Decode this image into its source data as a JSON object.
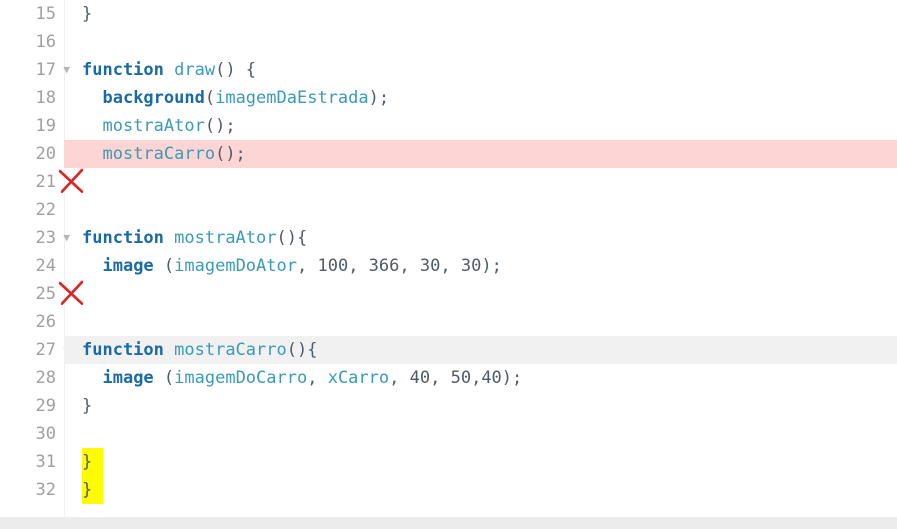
{
  "gutter": {
    "lines": [
      "15",
      "16",
      "17",
      "18",
      "19",
      "20",
      "21",
      "22",
      "23",
      "24",
      "25",
      "26",
      "27",
      "28",
      "29",
      "30",
      "31",
      "32"
    ]
  },
  "code": {
    "l15": {
      "t1": "}"
    },
    "l16": {},
    "l17": {
      "t1": "function",
      "t2": " ",
      "t3": "draw",
      "t4": "() {"
    },
    "l18": {
      "t1": "  ",
      "t2": "background",
      "t3": "(",
      "t4": "imagemDaEstrada",
      "t5": ");"
    },
    "l19": {
      "t1": "  ",
      "t2": "mostraAtor",
      "t3": "();"
    },
    "l20": {
      "t1": "  ",
      "t2": "mostraCarro",
      "t3": "();"
    },
    "l21": {},
    "l22": {},
    "l23": {
      "t1": "function",
      "t2": " ",
      "t3": "mostraAtor",
      "t4": "(){"
    },
    "l24": {
      "t1": "  ",
      "t2": "image",
      "t3": " (",
      "t4": "imagemDoAtor",
      "t5": ", ",
      "t6": "100",
      "t7": ", ",
      "t8": "366",
      "t9": ", ",
      "t10": "30",
      "t11": ", ",
      "t12": "30",
      "t13": ");"
    },
    "l25": {},
    "l26": {},
    "l27": {
      "t1": "function",
      "t2": " ",
      "t3": "mostraCarro",
      "t4": "(){"
    },
    "l28": {
      "t1": "  ",
      "t2": "image",
      "t3": " (",
      "t4": "imagemDoCarro",
      "t5": ", ",
      "t6": "xCarro",
      "t7": ", ",
      "t8": "40",
      "t9": ", ",
      "t10": "50",
      "t11": ",",
      "t12": "40",
      "t13": ");"
    },
    "l29": {
      "t1": "}"
    },
    "l30": {},
    "l31": {
      "t1": "}"
    },
    "l32": {
      "t1": "}"
    }
  },
  "fold_marker": "▼",
  "annotations": {
    "red_x": [
      {
        "line": 21
      },
      {
        "line": 25
      }
    ],
    "yellow_highlight_lines": [
      31,
      32
    ]
  }
}
